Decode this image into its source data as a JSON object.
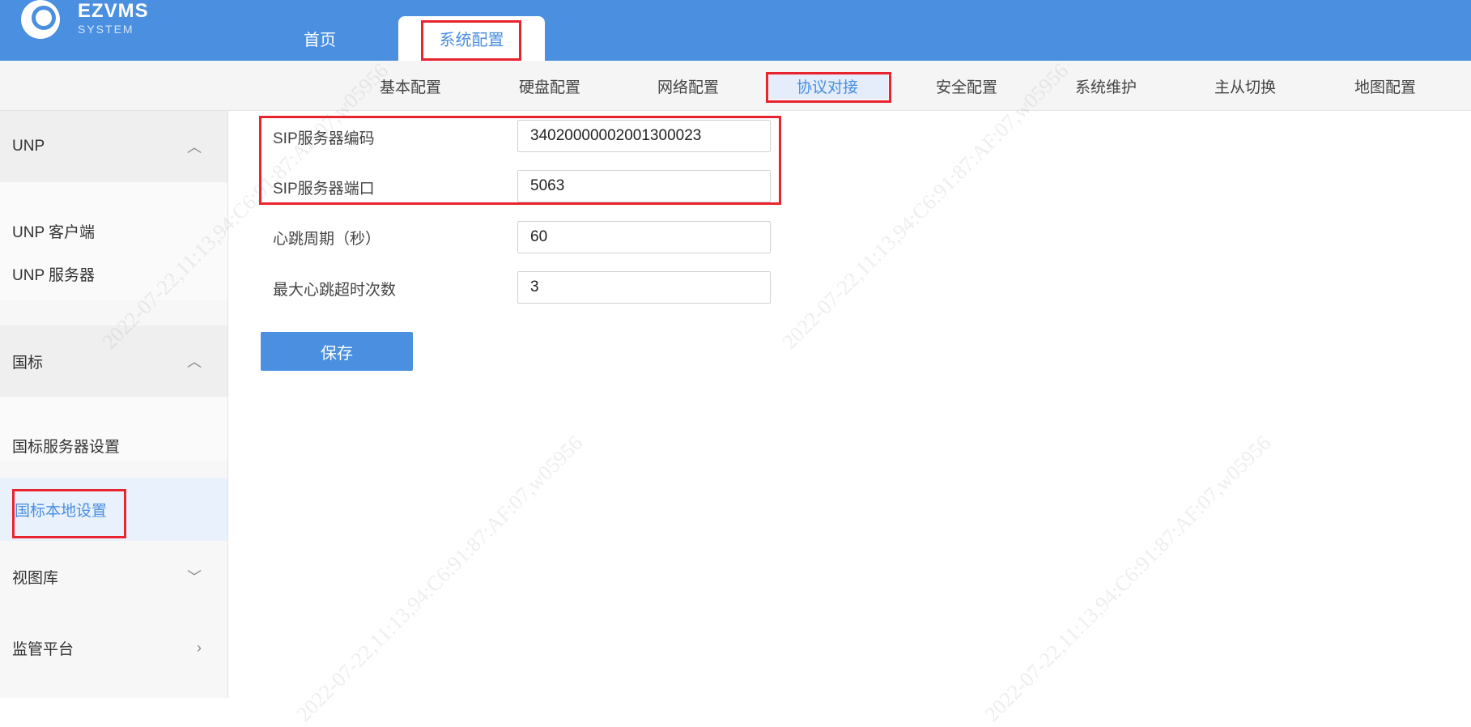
{
  "header": {
    "logo_name": "EZVMS",
    "logo_sub": "SYSTEM",
    "tabs": [
      {
        "label": "首页"
      },
      {
        "label": "系统配置"
      }
    ]
  },
  "subnav": {
    "items": [
      {
        "label": "基本配置"
      },
      {
        "label": "硬盘配置"
      },
      {
        "label": "网络配置"
      },
      {
        "label": "协议对接"
      },
      {
        "label": "安全配置"
      },
      {
        "label": "系统维护"
      },
      {
        "label": "主从切换"
      },
      {
        "label": "地图配置"
      }
    ]
  },
  "sidebar": {
    "groups": [
      {
        "label": "UNP"
      },
      {
        "label": "国标"
      },
      {
        "label": "视图库"
      },
      {
        "label": "监管平台"
      }
    ],
    "items": [
      {
        "label": "UNP 客户端"
      },
      {
        "label": "UNP 服务器"
      },
      {
        "label": "国标服务器设置"
      },
      {
        "label": "国标本地设置"
      }
    ]
  },
  "form": {
    "fields": [
      {
        "label": "SIP服务器编码",
        "value": "34020000002001300023"
      },
      {
        "label": "SIP服务器端口",
        "value": "5063"
      },
      {
        "label": "心跳周期（秒）",
        "value": "60"
      },
      {
        "label": "最大心跳超时次数",
        "value": "3"
      }
    ],
    "save_label": "保存"
  },
  "watermark": {
    "text": "2022-07-22,11:13,94:C6:91:87:AF:07,w05956"
  },
  "colors": {
    "primary": "#4a8fe0",
    "highlight": "#e8242f"
  }
}
